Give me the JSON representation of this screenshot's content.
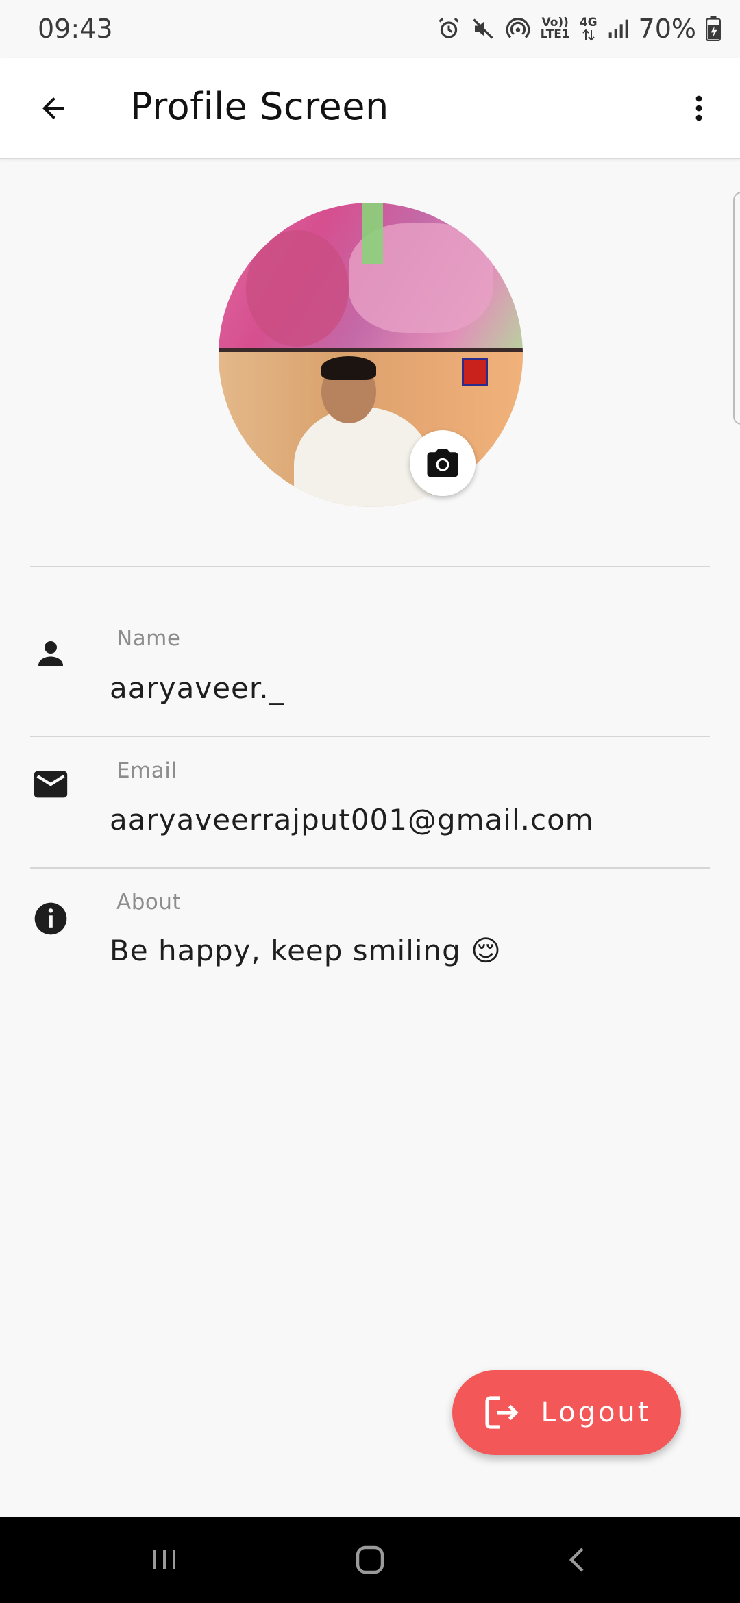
{
  "status_bar": {
    "time": "09:43",
    "network_top": "Vo))",
    "network_bottom": "LTE1",
    "network_gen": "4G",
    "battery": "70%"
  },
  "app_bar": {
    "title": "Profile Screen"
  },
  "profile": {
    "fields": [
      {
        "icon": "person-icon",
        "label": "Name",
        "value": "aaryaveer._"
      },
      {
        "icon": "email-icon",
        "label": "Email",
        "value": "aaryaveerrajput001@gmail.com"
      },
      {
        "icon": "info-icon",
        "label": "About",
        "value": "Be happy, keep smiling 😌"
      }
    ]
  },
  "actions": {
    "logout_label": "Logout"
  },
  "colors": {
    "accent": "#f45757",
    "background": "#f8f8f8",
    "app_bar": "#ffffff",
    "nav_bar": "#000000"
  }
}
